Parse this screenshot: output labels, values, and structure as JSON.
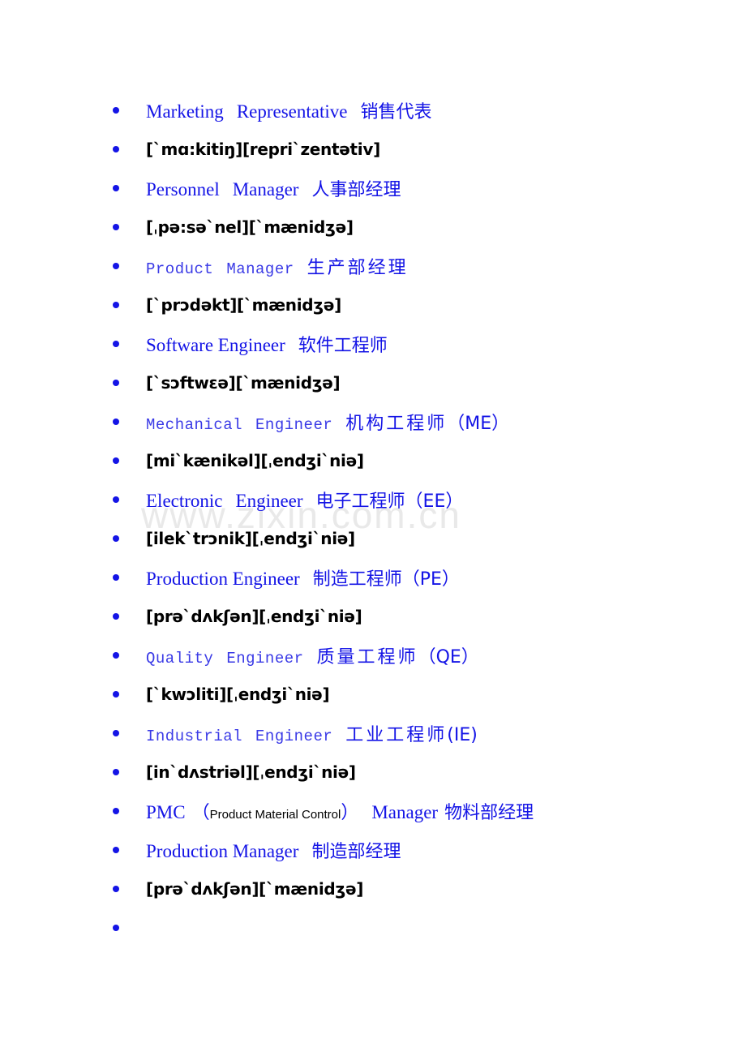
{
  "document": {
    "watermark": "www.zixin.com.cn",
    "bullet_color": "#1414e6",
    "text_color_blue": "#1414e6",
    "text_color_black": "#000000",
    "watermark_color": "#e9e9e9"
  },
  "lines": [
    {
      "kind": "entry",
      "style": "serif",
      "english": "Marketing",
      "english2": "Representative",
      "chinese": "销售代表",
      "abbr": ""
    },
    {
      "kind": "phonetic",
      "ipa": "[`mɑ:kitiŋ][repri`zentətiv]"
    },
    {
      "kind": "entry",
      "style": "serif",
      "english": "Personnel",
      "english2": "Manager",
      "chinese": "人事部经理",
      "abbr": ""
    },
    {
      "kind": "phonetic",
      "ipa": "[ˌpə:sə`nel][`mænidʒə]"
    },
    {
      "kind": "entry",
      "style": "mono",
      "english": "Product",
      "english2": "Manager",
      "chinese": "生产部经理",
      "abbr": ""
    },
    {
      "kind": "phonetic",
      "ipa": "[`prɔdəkt][`mænidʒə]"
    },
    {
      "kind": "entry",
      "style": "serif",
      "english": "Software Engineer",
      "english2": "",
      "chinese": "软件工程师",
      "abbr": ""
    },
    {
      "kind": "phonetic",
      "ipa": "[`sɔftwɛə][`mænidʒə]"
    },
    {
      "kind": "entry",
      "style": "mono",
      "english": "Mechanical",
      "english2": "Engineer",
      "chinese": "机构工程师",
      "abbr": "（ME）"
    },
    {
      "kind": "phonetic",
      "ipa": "[mi`kænikəl][ˌendʒi`niə]"
    },
    {
      "kind": "entry",
      "style": "serif",
      "english": "Electronic",
      "english2": "Engineer",
      "chinese": "电子工程师",
      "abbr": "（EE）"
    },
    {
      "kind": "phonetic",
      "ipa": "[ilek`trɔnik][ˌendʒi`niə]"
    },
    {
      "kind": "entry",
      "style": "serif",
      "english": "Production Engineer",
      "english2": "",
      "chinese": "制造工程师",
      "abbr": "（PE）"
    },
    {
      "kind": "phonetic",
      "ipa": "[prə`dʌkʃən][ˌendʒi`niə]"
    },
    {
      "kind": "entry",
      "style": "mono",
      "english": "Quality",
      "english2": "Engineer",
      "chinese": "质量工程师",
      "abbr": "（QE）"
    },
    {
      "kind": "phonetic",
      "ipa": "[`kwɔliti][ˌendʒi`niə]"
    },
    {
      "kind": "entry",
      "style": "mono",
      "english": "Industrial",
      "english2": "Engineer",
      "chinese": "工业工程师",
      "abbr": "(IE)"
    },
    {
      "kind": "phonetic",
      "ipa": "[in`dʌstriəl][ˌendʒi`niə]"
    },
    {
      "kind": "pmc",
      "abbr_label": "PMC",
      "paren_open": "（",
      "expansion": "Product Material Control",
      "paren_close": "）",
      "role": "Manager",
      "chinese": "物料部经理"
    },
    {
      "kind": "entry",
      "style": "serif",
      "english": "Production Manager",
      "english2": "",
      "chinese": "制造部经理",
      "abbr": ""
    },
    {
      "kind": "phonetic",
      "ipa": "[prə`dʌkʃən][`mænidʒə]"
    },
    {
      "kind": "empty"
    }
  ]
}
